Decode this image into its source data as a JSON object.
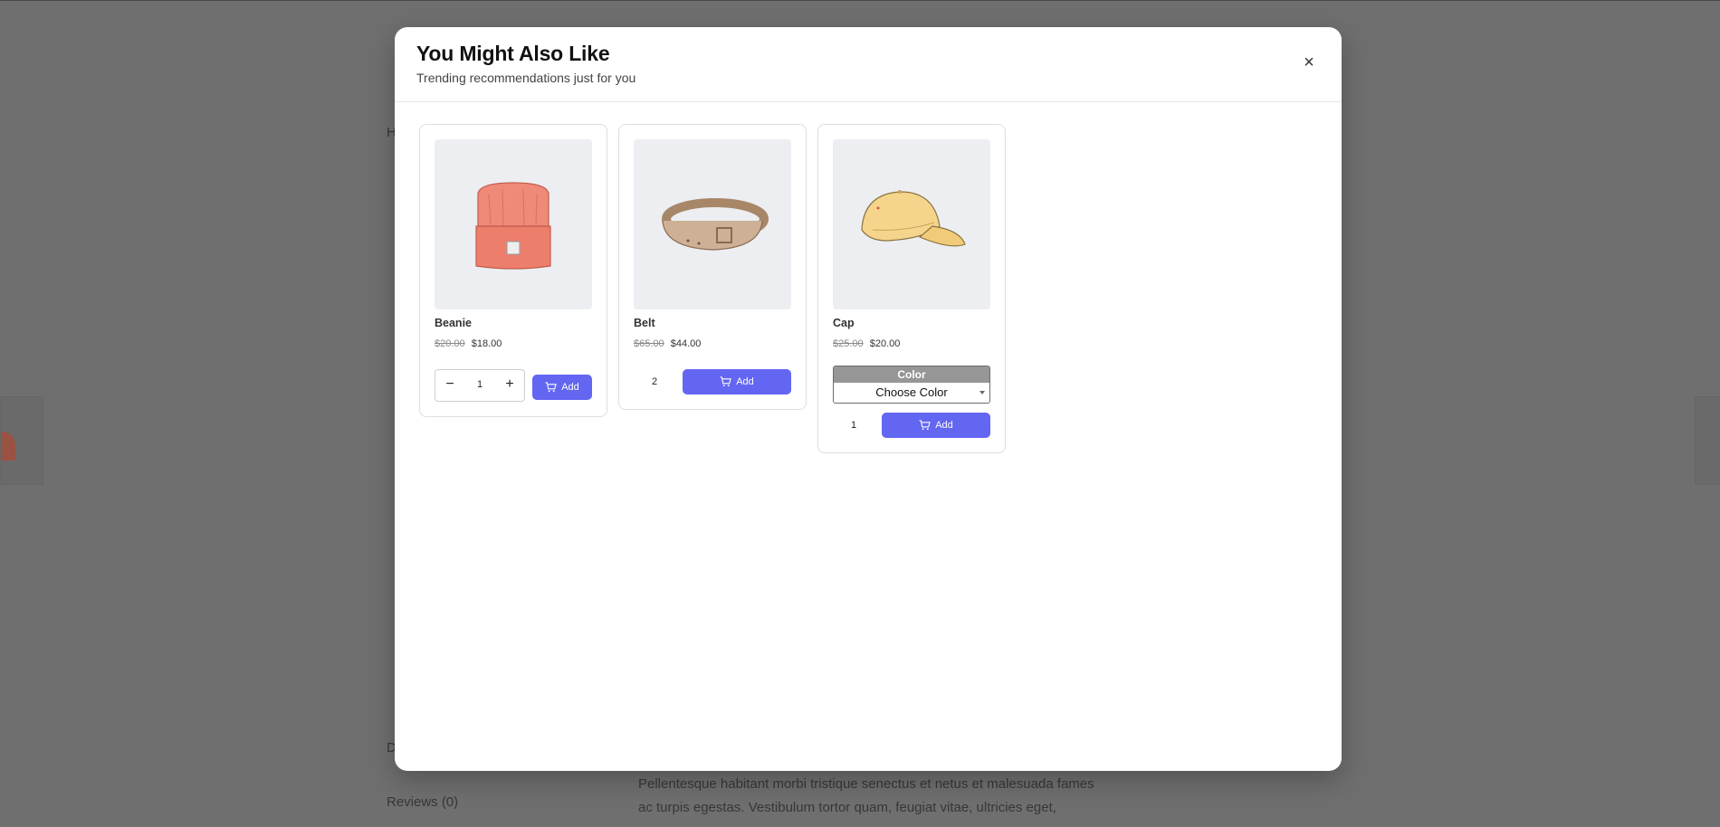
{
  "background": {
    "nav_partial": "H",
    "desc_tab_partial": "D",
    "reviews_tab": "Reviews (0)",
    "paragraph_line1": "Pellentesque habitant morbi tristique senectus et netus et malesuada fames",
    "paragraph_line2": "ac turpis egestas. Vestibulum tortor quam, feugiat vitae, ultricies eget,"
  },
  "modal": {
    "title": "You Might Also Like",
    "subtitle": "Trending recommendations just for you",
    "close_label": "×"
  },
  "products": [
    {
      "name": "Beanie",
      "old_price": "$20.00",
      "price": "$18.00",
      "quantity": "1",
      "add_label": "Add",
      "minus_label": "−",
      "plus_label": "+",
      "image_color": "#f08a78"
    },
    {
      "name": "Belt",
      "old_price": "$65.00",
      "price": "$44.00",
      "quantity": "2",
      "add_label": "Add",
      "image_color": "#c9a889"
    },
    {
      "name": "Cap",
      "old_price": "$25.00",
      "price": "$20.00",
      "quantity": "1",
      "add_label": "Add",
      "color_label": "Color",
      "color_value": "Choose Color",
      "image_color": "#f5d58c"
    }
  ],
  "accent_color": "#6366f1"
}
